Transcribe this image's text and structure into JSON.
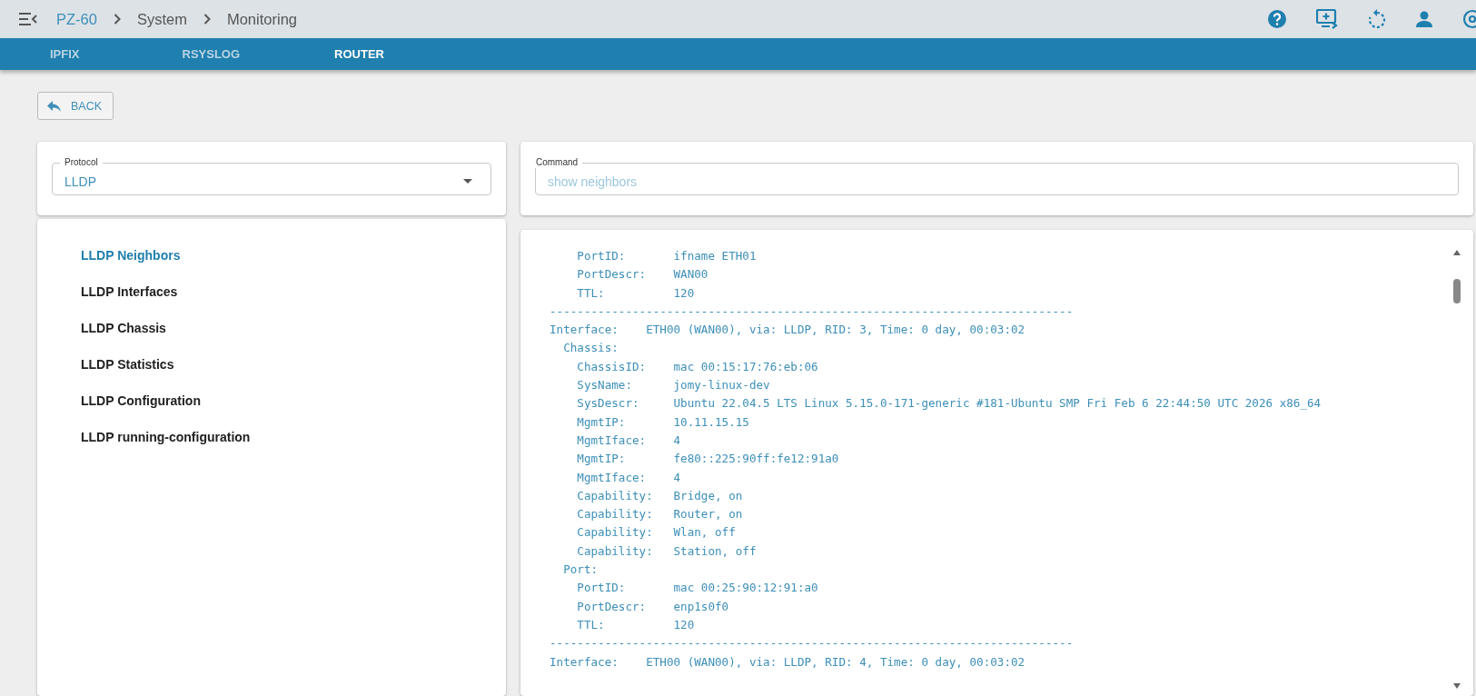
{
  "topbar": {
    "breadcrumb": [
      {
        "label": "PZ-60",
        "kind": "link"
      },
      {
        "label": "System",
        "kind": "text"
      },
      {
        "label": "Monitoring",
        "kind": "text"
      }
    ]
  },
  "tabs": [
    {
      "label": "IPFIX",
      "selected": false
    },
    {
      "label": "RSYSLOG",
      "selected": false
    },
    {
      "label": "ROUTER",
      "selected": true
    }
  ],
  "back_button": {
    "label": "BACK"
  },
  "protocol_select": {
    "label": "Protocol",
    "value": "LLDP"
  },
  "menu": [
    {
      "label": "LLDP Neighbors",
      "selected": true
    },
    {
      "label": "LLDP Interfaces",
      "selected": false
    },
    {
      "label": "LLDP Chassis",
      "selected": false
    },
    {
      "label": "LLDP Statistics",
      "selected": false
    },
    {
      "label": "LLDP Configuration",
      "selected": false
    },
    {
      "label": "LLDP running-configuration",
      "selected": false
    }
  ],
  "command_field": {
    "label": "Command",
    "placeholder": "show neighbors"
  },
  "output": [
    "    PortID:       ifname ETH01",
    "    PortDescr:    WAN00",
    "    TTL:          120",
    "----------------------------------------------------------------------------",
    "Interface:    ETH00 (WAN00), via: LLDP, RID: 3, Time: 0 day, 00:03:02",
    "  Chassis:",
    "    ChassisID:    mac 00:15:17:76:eb:06",
    "    SysName:      jomy-linux-dev",
    "    SysDescr:     Ubuntu 22.04.5 LTS Linux 5.15.0-171-generic #181-Ubuntu SMP Fri Feb 6 22:44:50 UTC 2026 x86_64",
    "    MgmtIP:       10.11.15.15",
    "    MgmtIface:    4",
    "    MgmtIP:       fe80::225:90ff:fe12:91a0",
    "    MgmtIface:    4",
    "    Capability:   Bridge, on",
    "    Capability:   Router, on",
    "    Capability:   Wlan, off",
    "    Capability:   Station, off",
    "  Port:",
    "    PortID:       mac 00:25:90:12:91:a0",
    "    PortDescr:    enp1s0f0",
    "    TTL:          120",
    "----------------------------------------------------------------------------",
    "Interface:    ETH00 (WAN00), via: LLDP, RID: 4, Time: 0 day, 00:03:02"
  ]
}
